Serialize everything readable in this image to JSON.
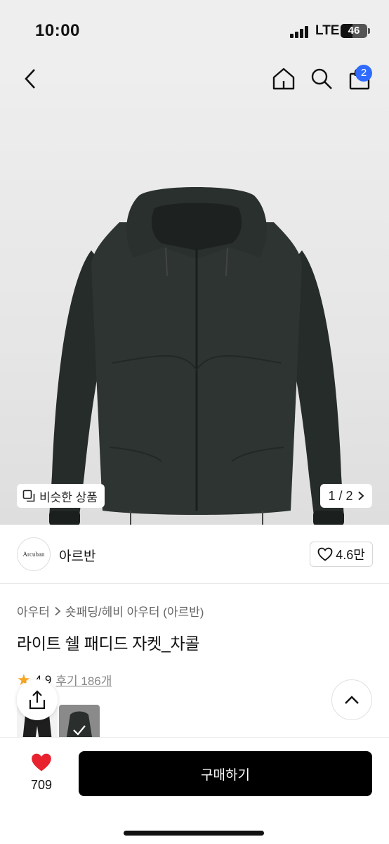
{
  "status_bar": {
    "time": "10:00",
    "network": "LTE",
    "battery": "46",
    "battery_level": 0.46
  },
  "header": {
    "back_icon": "chevron-left-icon",
    "home_icon": "home-icon",
    "search_icon": "search-icon",
    "bag_icon": "shopping-bag-icon",
    "cart_count": "2"
  },
  "gallery": {
    "similar_label": "비슷한 상품",
    "page_indicator": "1 / 2"
  },
  "brand": {
    "logo_text": "Arcuban",
    "name": "아르반",
    "likes": "4.6만"
  },
  "breadcrumb": {
    "category": "아우터",
    "subcategory": "숏패딩/헤비 아우터 (아르반)"
  },
  "product": {
    "title": "라이트 쉘 패디드 자켓_차콜",
    "rating": "4.9",
    "reviews": "후기 186개"
  },
  "bottom_bar": {
    "wish_count": "709",
    "buy_label": "구매하기"
  },
  "colors": {
    "accent_blue": "#2f6bff",
    "heart_red": "#e8222e",
    "star": "#f5a623",
    "jacket": "#2b312f"
  }
}
